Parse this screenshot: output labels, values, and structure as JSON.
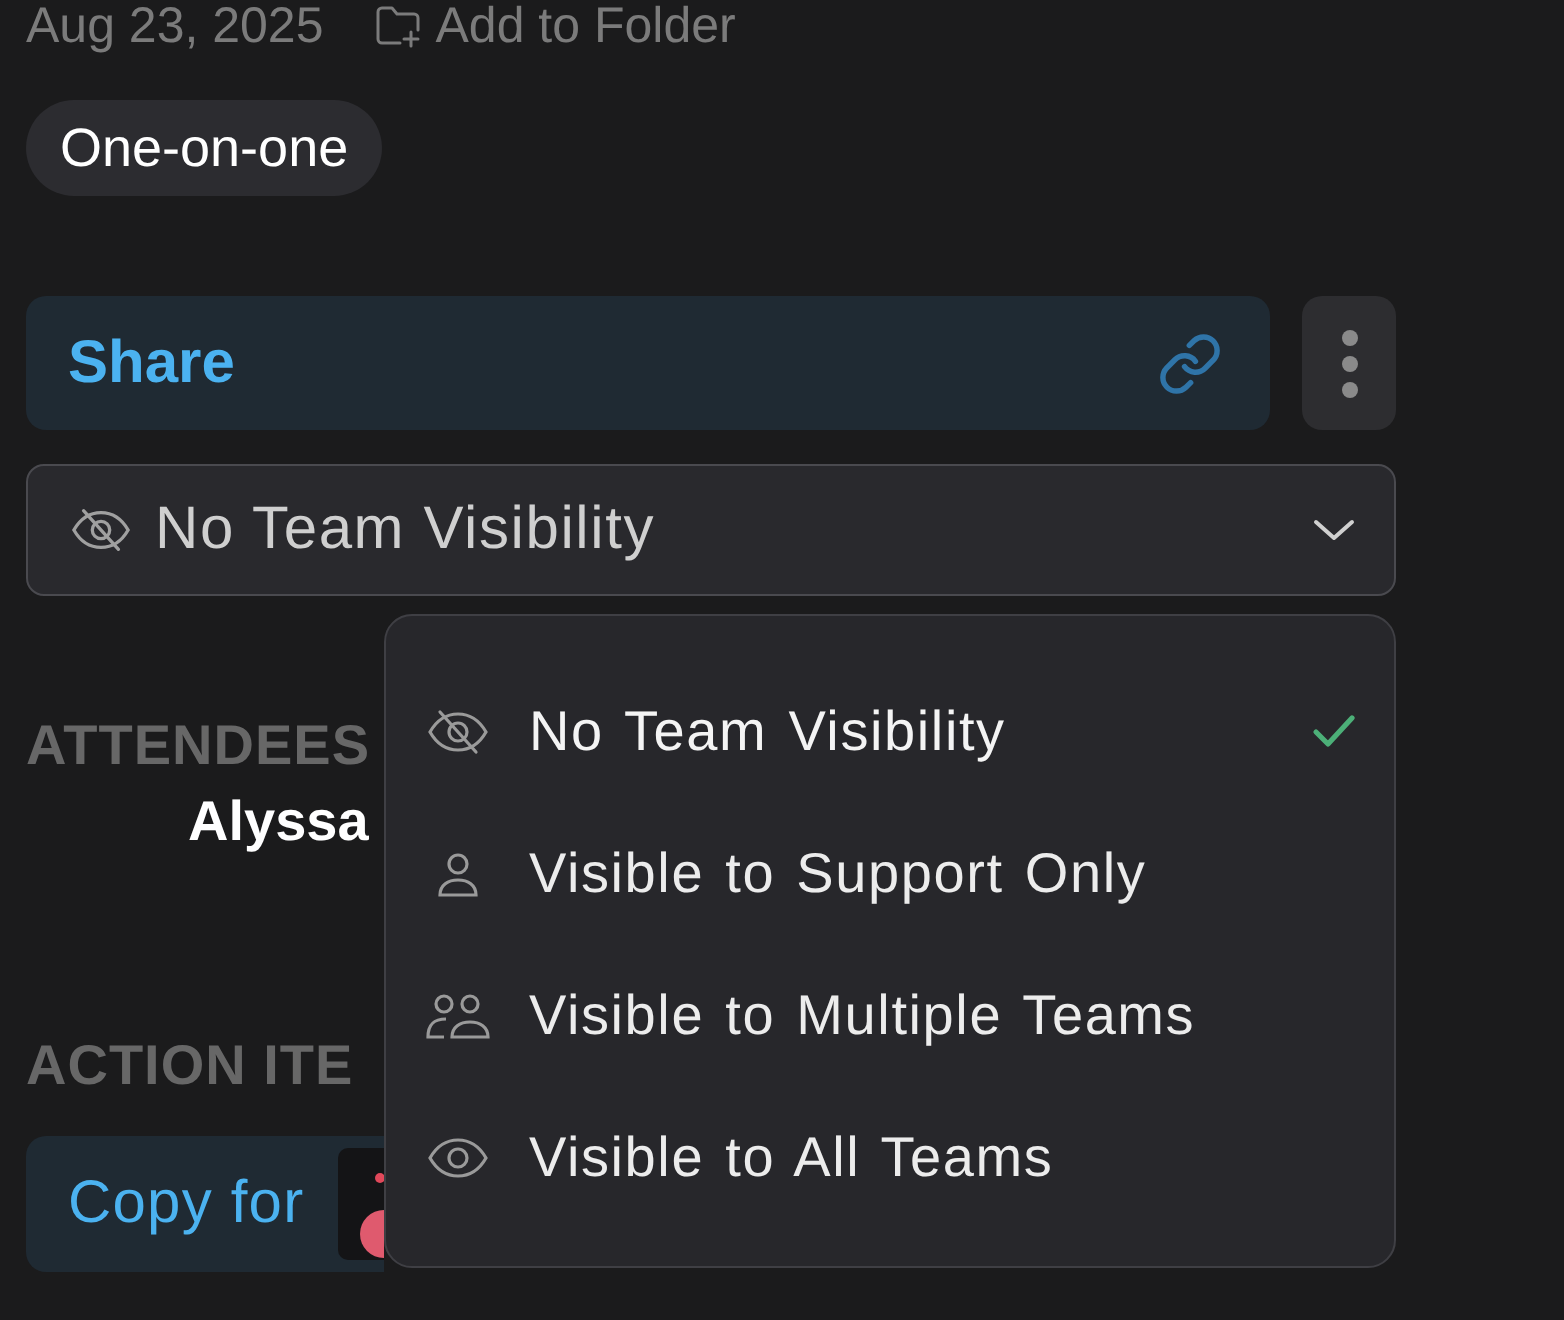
{
  "meta": {
    "date": "Aug 23, 2025",
    "add_to_folder": "Add to Folder"
  },
  "tags": [
    {
      "label": "One-on-one"
    }
  ],
  "share": {
    "label": "Share"
  },
  "visibility_select": {
    "kind": "hidden",
    "value": "No Team Visibility",
    "expanded": true,
    "options": [
      {
        "kind": "hidden",
        "label": "No Team Visibility",
        "selected": true
      },
      {
        "kind": "support",
        "label": "Visible to Support Only",
        "selected": false
      },
      {
        "kind": "teams",
        "label": "Visible to Multiple Teams",
        "selected": false
      },
      {
        "kind": "all",
        "label": "Visible to All Teams",
        "selected": false
      }
    ]
  },
  "attendees": {
    "heading": "ATTENDEES",
    "names": [
      "Alyssa"
    ]
  },
  "action_items": {
    "heading": "ACTION ITE",
    "copy_button": "Copy for"
  }
}
